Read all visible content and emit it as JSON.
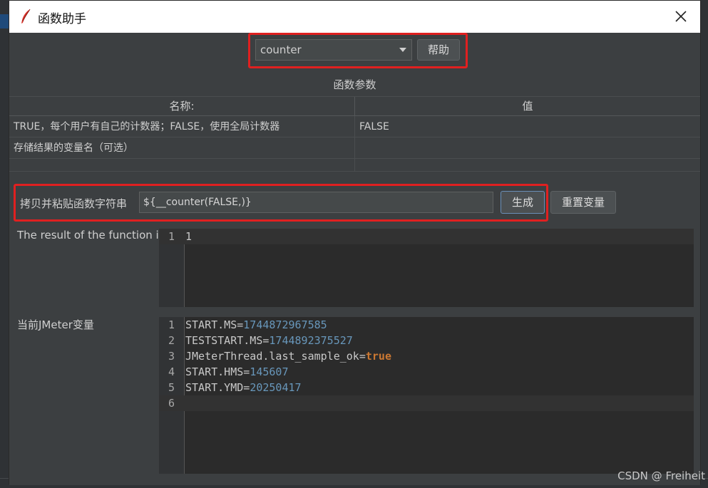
{
  "window": {
    "title": "函数助手",
    "close_label": "✕"
  },
  "function_select": {
    "value": "counter",
    "help_label": "帮助"
  },
  "params_section": {
    "title": "函数参数",
    "columns": [
      "名称:",
      "值"
    ],
    "rows": [
      {
        "name": "TRUE，每个用户有自己的计数器；FALSE，使用全局计数器",
        "value": "FALSE"
      },
      {
        "name": "存储结果的变量名（可选）",
        "value": ""
      }
    ]
  },
  "copy_section": {
    "label": "拷贝并粘贴函数字符串",
    "value": "${__counter(FALSE,)}",
    "generate_label": "生成",
    "reset_label": "重置变量"
  },
  "result": {
    "label": "The result of the function is",
    "lines": [
      {
        "ln": "1",
        "value": "1"
      }
    ]
  },
  "jmeter_vars": {
    "label": "当前JMeter变量",
    "lines": [
      {
        "ln": "1",
        "key": "START.MS=",
        "value": "1744872967585"
      },
      {
        "ln": "2",
        "key": "TESTSTART.MS=",
        "value": "1744892375527"
      },
      {
        "ln": "3",
        "key": "JMeterThread.last_sample_ok=",
        "value": "true"
      },
      {
        "ln": "4",
        "key": "START.HMS=",
        "value": "145607"
      },
      {
        "ln": "5",
        "key": "START.YMD=",
        "value": "20250417"
      },
      {
        "ln": "6",
        "key": "",
        "value": ""
      }
    ]
  },
  "watermark": "CSDN @ Freiheit",
  "colors": {
    "highlight_border": "#e02020",
    "number": "#6897bb",
    "keyword": "#cc7832"
  }
}
